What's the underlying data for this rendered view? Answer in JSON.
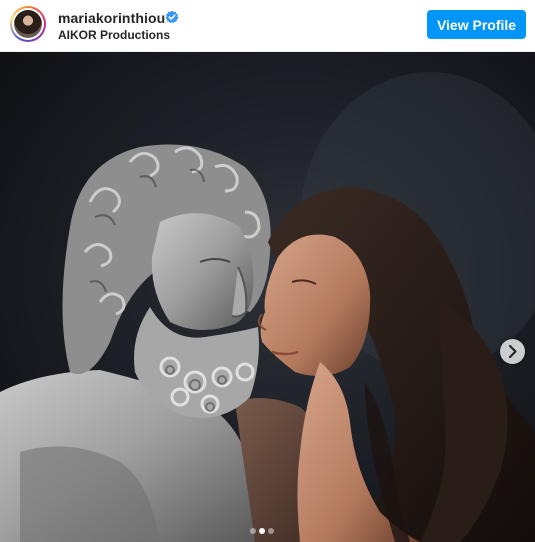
{
  "post": {
    "username": "mariakorinthiou",
    "subtitle": "AIKOR Productions",
    "verified_icon": "verified-badge-icon",
    "view_profile_label": "View Profile"
  },
  "carousel": {
    "next_icon": "chevron-right-icon",
    "slide_count": 3,
    "active_slide": 2
  },
  "colors": {
    "accent": "#0095f6",
    "text": "#262626",
    "photo_background": "#15181f"
  }
}
